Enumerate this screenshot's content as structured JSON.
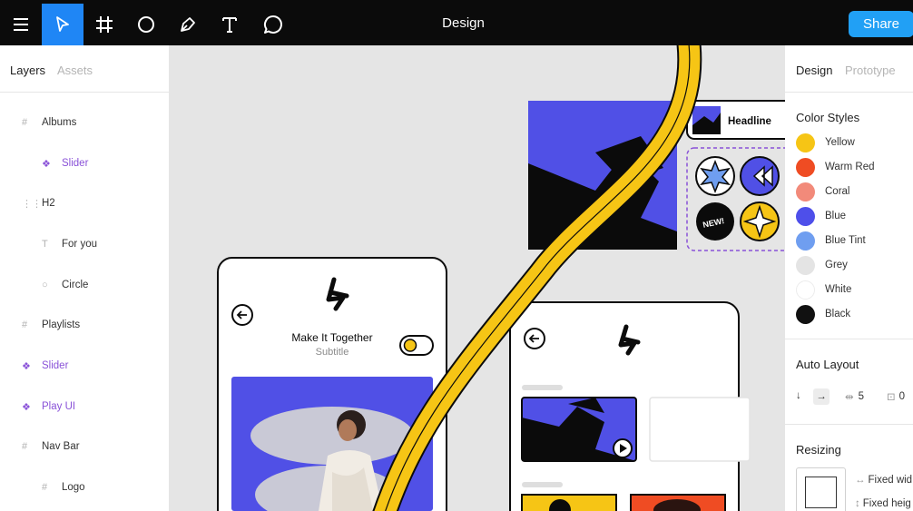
{
  "toolbar": {
    "title": "Design",
    "share_label": "Share",
    "tools": [
      "menu-icon",
      "move-icon",
      "frame-icon",
      "ellipse-icon",
      "pen-icon",
      "text-icon",
      "comment-icon"
    ]
  },
  "left_panel": {
    "tabs": {
      "layers": "Layers",
      "assets": "Assets"
    },
    "layers": [
      {
        "label": "Albums",
        "icon": "frame-icon"
      },
      {
        "label": "Slider",
        "icon": "component-icon"
      },
      {
        "label": "H2",
        "icon": "dashed-frame-icon"
      },
      {
        "label": "For you",
        "icon": "text-icon"
      },
      {
        "label": "Circle",
        "icon": "ellipse-icon"
      },
      {
        "label": "Playlists",
        "icon": "frame-icon"
      },
      {
        "label": "Slider",
        "icon": "component-icon"
      },
      {
        "label": "Play UI",
        "icon": "component-icon"
      },
      {
        "label": "Nav Bar",
        "icon": "frame-icon"
      },
      {
        "label": "Logo",
        "icon": "frame-icon"
      }
    ]
  },
  "canvas": {
    "headline_label": "Headline",
    "new_badge": "NEW!",
    "card1": {
      "title": "Make It Together",
      "subtitle": "Subtitle"
    }
  },
  "right_panel": {
    "tabs": {
      "design": "Design",
      "prototype": "Prototype"
    },
    "color_styles": {
      "heading": "Color Styles",
      "items": [
        {
          "name": "Yellow",
          "color": "#f6c515"
        },
        {
          "name": "Warm Red",
          "color": "#ef4c23"
        },
        {
          "name": "Coral",
          "color": "#f28a7a"
        },
        {
          "name": "Blue",
          "color": "#4e4fea"
        },
        {
          "name": "Blue Tint",
          "color": "#6f9ef0"
        },
        {
          "name": "Grey",
          "color": "#e4e4e4"
        },
        {
          "name": "White",
          "color": "#ffffff"
        },
        {
          "name": "Black",
          "color": "#111111"
        }
      ]
    },
    "auto_layout": {
      "heading": "Auto Layout",
      "spacing": "5",
      "padding": "0"
    },
    "resizing": {
      "heading": "Resizing",
      "width_label": "Fixed wid",
      "height_label": "Fixed heig"
    }
  },
  "colors": {
    "accent": "#1f86f5",
    "share": "#21a0f5",
    "yellow": "#f6c515",
    "purple": "#8a52d8",
    "blue": "#5050e6"
  }
}
